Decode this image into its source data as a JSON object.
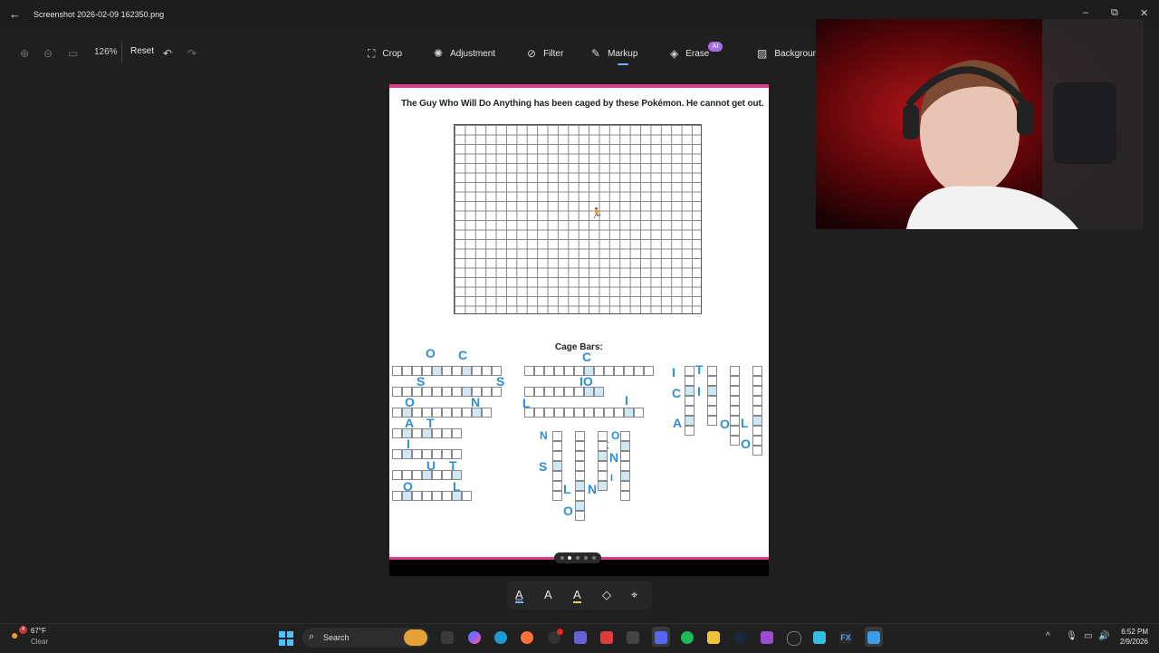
{
  "window": {
    "title": "Screenshot 2026-02-09 162350.png",
    "back_icon": "arrow-left-icon",
    "controls": [
      "minimize-icon",
      "maximize-icon",
      "close-icon"
    ]
  },
  "toolbar": {
    "zoom_in_icon": "zoom-in-icon",
    "zoom_out_icon": "zoom-out-icon",
    "fit_icon": "fit-icon",
    "zoom_level": "126%",
    "reset_label": "Reset",
    "undo_icon": "undo-icon",
    "redo_icon": "redo-icon",
    "tools": [
      {
        "label": "Crop",
        "icon": "crop-icon"
      },
      {
        "label": "Adjustment",
        "icon": "adjustment-icon"
      },
      {
        "label": "Filter",
        "icon": "filter-icon"
      },
      {
        "label": "Markup",
        "icon": "markup-pen-icon",
        "active": true
      },
      {
        "label": "Erase",
        "icon": "erase-icon",
        "badge": "AI"
      },
      {
        "label": "Backgrounc",
        "icon": "background-icon"
      }
    ]
  },
  "puzzle": {
    "title": "The Guy Who Will Do Anything has been caged by these Pokémon. He cannot get out.",
    "cage_title": "Cage Bars:",
    "handwriting": [
      "O",
      "C",
      "S",
      "S",
      "O",
      "N",
      "A",
      "T",
      "I",
      "U",
      "T",
      "O",
      "L",
      "C",
      "L",
      "IO",
      "I",
      "N",
      "O",
      "S",
      "N",
      "L",
      "N",
      "I",
      "O",
      "I",
      "T",
      "C",
      "I",
      "A",
      "O",
      "L",
      "O",
      "U"
    ]
  },
  "bottom_tools": [
    "ballpoint-pen-icon",
    "pencil-icon",
    "highlighter-icon",
    "eraser-icon",
    "ruler-icon"
  ],
  "taskbar": {
    "weather_temp": "67°F",
    "weather_desc": "Clear",
    "weather_badge": "4",
    "search_placeholder": "Search",
    "time": "6:52 PM",
    "date": "2/9/2026"
  }
}
